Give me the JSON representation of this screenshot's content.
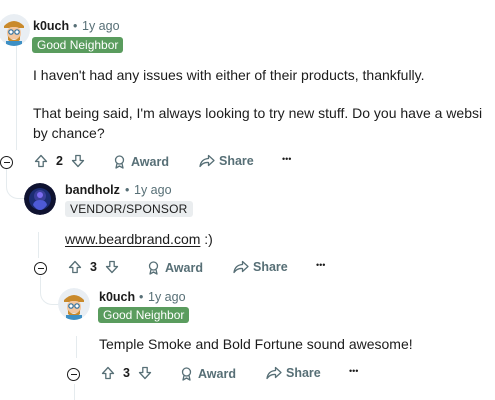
{
  "comments": [
    {
      "username": "k0uch",
      "separator": "•",
      "time": "1y ago",
      "flair": "Good Neighbor",
      "body": [
        "I haven't had any issues with either of their products, thankfully.",
        "That being said, I'm always looking to try new stuff. Do you have a websi",
        "by chance?"
      ],
      "votes": "2",
      "award_label": "Award",
      "share_label": "Share",
      "more_label": "•••"
    },
    {
      "username": "bandholz",
      "separator": "•",
      "time": "1y ago",
      "flair": "VENDOR/SPONSOR",
      "link": "www.beardbrand.com",
      "body_suffix": " :)",
      "votes": "3",
      "award_label": "Award",
      "share_label": "Share",
      "more_label": "•••"
    },
    {
      "username": "k0uch",
      "separator": "•",
      "time": "1y ago",
      "flair": "Good Neighbor",
      "body": "Temple Smoke and Bold Fortune sound awesome!",
      "votes": "3",
      "award_label": "Award",
      "share_label": "Share",
      "more_label": "•••"
    }
  ],
  "colors": {
    "flair_green": "#5a9c5e",
    "meta_grey": "#576f76",
    "thread_line": "#e5ebee"
  }
}
